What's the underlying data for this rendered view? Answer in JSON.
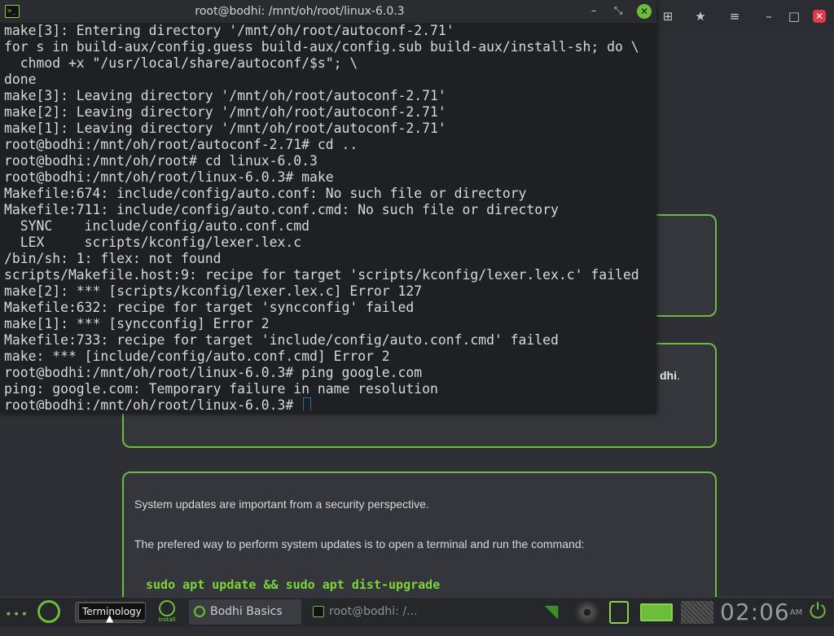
{
  "terminal": {
    "title": "root@bodhi: /mnt/oh/root/linux-6.0.3",
    "icon": "terminal-icon",
    "controls": {
      "minimize": "–",
      "maximize": "⤡",
      "close": "✕"
    },
    "lines": [
      "make[3]: Entering directory '/mnt/oh/root/autoconf-2.71'",
      "for s in build-aux/config.guess build-aux/config.sub build-aux/install-sh; do \\",
      "  chmod +x \"/usr/local/share/autoconf/$s\"; \\",
      "done",
      "make[3]: Leaving directory '/mnt/oh/root/autoconf-2.71'",
      "make[2]: Leaving directory '/mnt/oh/root/autoconf-2.71'",
      "make[1]: Leaving directory '/mnt/oh/root/autoconf-2.71'",
      "root@bodhi:/mnt/oh/root/autoconf-2.71# cd ..",
      "root@bodhi:/mnt/oh/root# cd linux-6.0.3",
      "root@bodhi:/mnt/oh/root/linux-6.0.3# make",
      "Makefile:674: include/config/auto.conf: No such file or directory",
      "Makefile:711: include/config/auto.conf.cmd: No such file or directory",
      "  SYNC    include/config/auto.conf.cmd",
      "  LEX     scripts/kconfig/lexer.lex.c",
      "/bin/sh: 1: flex: not found",
      "scripts/Makefile.host:9: recipe for target 'scripts/kconfig/lexer.lex.c' failed",
      "make[2]: *** [scripts/kconfig/lexer.lex.c] Error 127",
      "Makefile:632: recipe for target 'syncconfig' failed",
      "make[1]: *** [syncconfig] Error 2",
      "Makefile:733: recipe for target 'include/config/auto.conf.cmd' failed",
      "make: *** [include/config/auto.conf.cmd] Error 2",
      "root@bodhi:/mnt/oh/root/linux-6.0.3# ping google.com",
      "ping: google.com: Temporary failure in name resolution",
      "root@bodhi:/mnt/oh/root/linux-6.0.3# "
    ]
  },
  "page": {
    "card2_fragment_bold": "dhi",
    "card2_fragment_tail": ".",
    "card3_line1": "System updates are important from a security perspective.",
    "card3_line2": "The prefered way to perform system updates is to open a terminal and run the command:",
    "card3_command": "sudo apt update && sudo apt dist-upgrade",
    "accent_color": "#6bbd3a"
  },
  "browser_toolbar": {
    "icons": [
      "plus-icon",
      "bookmark-star-icon",
      "menu-icon"
    ],
    "controls": {
      "minimize": "–",
      "maximize": "□",
      "close": "✕"
    }
  },
  "taskbar": {
    "dots": "∙∙∙",
    "tooltip": "Terminology",
    "install_label": "Install",
    "tasks": [
      {
        "label": "Bodhi Basics"
      },
      {
        "label": "root@bodhi: /..."
      }
    ],
    "clock": "02:06",
    "clock_ampm": "AM"
  }
}
